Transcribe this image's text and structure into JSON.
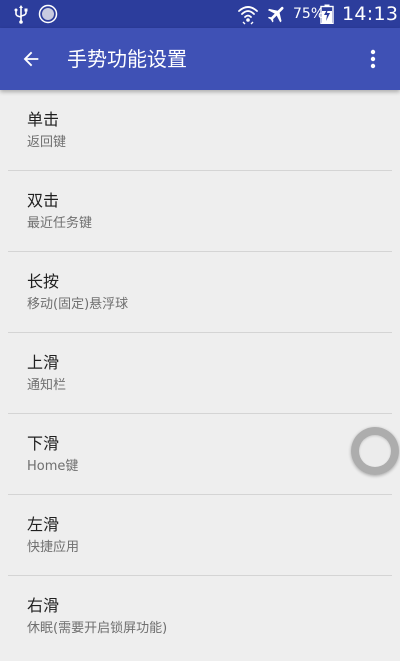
{
  "status_bar": {
    "battery_percent": "75%",
    "clock": "14:13"
  },
  "toolbar": {
    "title": "手势功能设置"
  },
  "gestures": [
    {
      "title": "单击",
      "action": "返回键"
    },
    {
      "title": "双击",
      "action": "最近任务键"
    },
    {
      "title": "长按",
      "action": "移动(固定)悬浮球"
    },
    {
      "title": "上滑",
      "action": "通知栏"
    },
    {
      "title": "下滑",
      "action": "Home键"
    },
    {
      "title": "左滑",
      "action": "快捷应用"
    },
    {
      "title": "右滑",
      "action": "休眠(需要开启锁屏功能)"
    }
  ],
  "colors": {
    "status_bar": "#2c3d9c",
    "toolbar": "#3f51b5",
    "background": "#eeeeee"
  }
}
